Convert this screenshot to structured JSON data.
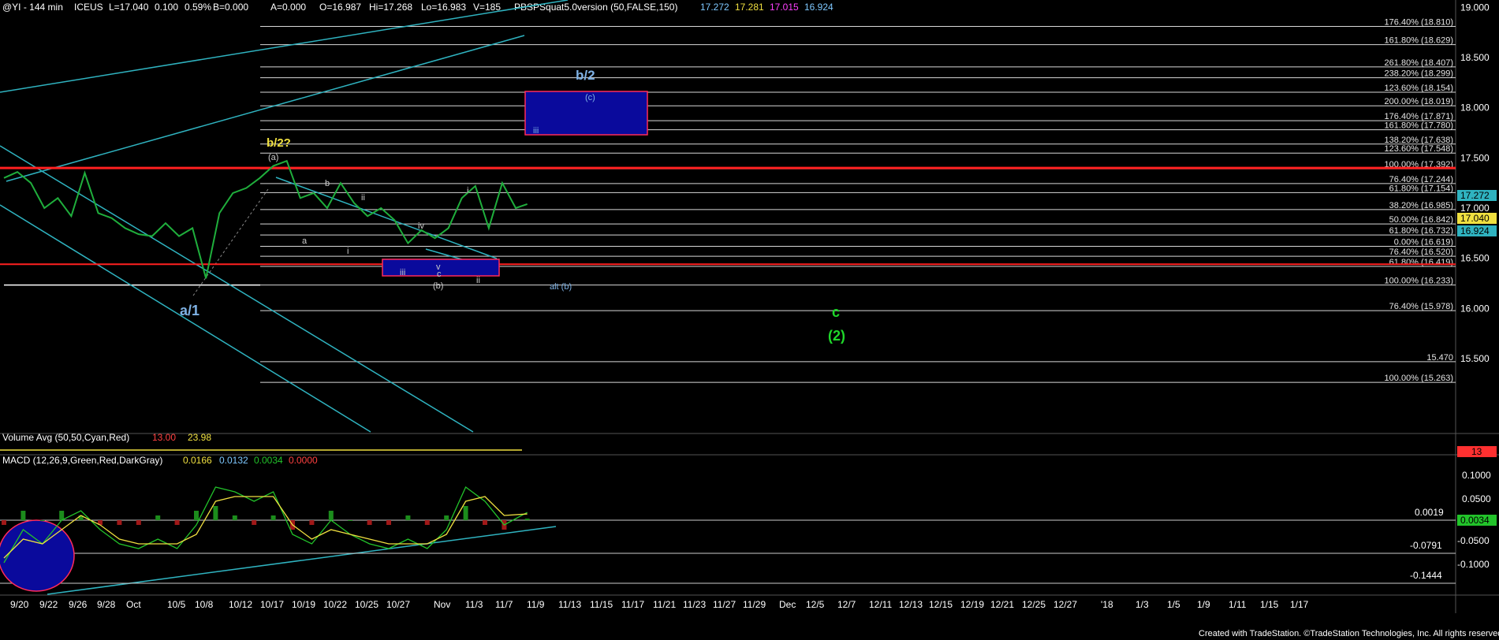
{
  "header": {
    "symbol": "@YI - 144 min",
    "exchange": "ICEUS",
    "last": "L=17.040",
    "change": "0.100",
    "change_pct": "0.59%",
    "b": "B=0.000",
    "a": "A=0.000",
    "open": "O=16.987",
    "hi": "Hi=17.268",
    "lo": "Lo=16.983",
    "vol": "V=185",
    "study": "PBSPSquat5.0version (50,FALSE,150)",
    "v1": "17.272",
    "v2": "17.281",
    "v3": "17.015",
    "v4": "16.924"
  },
  "colors": {
    "background": "#000000",
    "price_bars": "#1fae3c",
    "fib_line": "#e6e6e6",
    "fib_text": "#e6e6e6",
    "red_level": "#ff2020",
    "channel": "#2fb3c0",
    "box_fill": "#0a0a9c",
    "box_border": "#ff2b5a",
    "wave_label_blue": "#7fb2e5",
    "wave_label_yellow": "#f0e040",
    "wave_label_green": "#1fd82a",
    "macd_line": "#22c32a",
    "signal_line": "#f0e040",
    "hist_pos": "#1c8c1c",
    "hist_neg": "#a01818"
  },
  "chart_data": [
    {
      "type": "line",
      "title": "",
      "xlabel": "",
      "ylabel": "",
      "ylim": [
        15.15,
        19.03
      ],
      "price_axis_ticks": [
        "19.000",
        "18.500",
        "18.000",
        "17.500",
        "17.000",
        "16.500",
        "16.000",
        "15.500"
      ],
      "date_axis_ticks": [
        "9/20",
        "9/22",
        "9/26",
        "9/28",
        "Oct",
        "10/5",
        "10/8",
        "10/12",
        "10/17",
        "10/19",
        "10/22",
        "10/25",
        "10/27",
        "Nov",
        "11/3",
        "11/7",
        "11/9",
        "11/13",
        "11/15",
        "11/17",
        "11/21",
        "11/23",
        "11/27",
        "11/29",
        "Dec",
        "12/5",
        "12/7",
        "12/11",
        "12/13",
        "12/15",
        "12/19",
        "12/21",
        "12/25",
        "12/27",
        "'18",
        "1/3",
        "1/5",
        "1/9",
        "1/11",
        "1/15",
        "1/17"
      ],
      "series": [
        {
          "x": [
            0,
            14,
            28,
            42,
            56,
            70,
            84,
            98,
            112,
            126,
            140,
            154,
            168,
            182,
            196,
            210,
            224,
            238,
            252,
            266,
            280,
            294,
            308,
            322,
            336,
            350,
            364,
            378,
            392,
            406,
            420,
            434,
            448,
            462,
            476,
            490,
            504,
            518,
            532,
            544
          ],
          "values": [
            17.3,
            17.36,
            17.25,
            17.0,
            17.1,
            16.92,
            17.35,
            16.95,
            16.9,
            16.8,
            16.74,
            16.72,
            16.85,
            16.72,
            16.8,
            16.3,
            16.95,
            17.15,
            17.2,
            17.3,
            17.42,
            17.47,
            17.1,
            17.15,
            17.0,
            17.25,
            17.05,
            16.92,
            17.0,
            16.88,
            16.65,
            16.78,
            16.7,
            16.8,
            17.1,
            17.22,
            16.8,
            17.25,
            17.0,
            17.04
          ]
        }
      ],
      "fib_levels": [
        {
          "label": "176.40% (18.810)",
          "value": 18.81
        },
        {
          "label": "161.80% (18.629)",
          "value": 18.629
        },
        {
          "label": "261.80% (18.407)",
          "value": 18.407
        },
        {
          "label": "238.20% (18.299)",
          "value": 18.299
        },
        {
          "label": "123.60% (18.154)",
          "value": 18.154
        },
        {
          "label": "200.00% (18.019)",
          "value": 18.019
        },
        {
          "label": "176.40% (17.871)",
          "value": 17.871
        },
        {
          "label": "161.80% (17.780)",
          "value": 17.78
        },
        {
          "label": "138.20% (17.638)",
          "value": 17.638
        },
        {
          "label": "123.60% (17.548)",
          "value": 17.548
        },
        {
          "label": "100.00% (17.392)",
          "value": 17.392
        },
        {
          "label": "76.40% (17.244)",
          "value": 17.244
        },
        {
          "label": "61.80% (17.154)",
          "value": 17.154
        },
        {
          "label": "38.20% (16.985)",
          "value": 16.985
        },
        {
          "label": "50.00% (16.842)",
          "value": 16.842
        },
        {
          "label": "61.80% (16.732)",
          "value": 16.732
        },
        {
          "label": "0.00% (16.619)",
          "value": 16.619
        },
        {
          "label": "76.40% (16.520)",
          "value": 16.52
        },
        {
          "label": "61.80% (16.419)",
          "value": 16.419
        },
        {
          "label": "100.00% (16.233)",
          "value": 16.233
        },
        {
          "label": "76.40% (15.978)",
          "value": 15.978
        },
        {
          "label": "15.470",
          "value": 15.47
        },
        {
          "label": "100.00% (15.263)",
          "value": 15.263
        }
      ],
      "red_levels": [
        17.4,
        16.44
      ],
      "wave_labels": {
        "b2_top": "b/2",
        "c_paren": "(c)",
        "iii_box": "iii",
        "b2q": "b/2?",
        "a_paren": "(a)",
        "b_small": "b",
        "ii_small": "ii",
        "a_small": "a",
        "i_small": "i",
        "i_right": "i",
        "iv": "iv",
        "iii_low": "iii",
        "v_low": "v",
        "c_low": "c",
        "b_paren": "(b)",
        "ii_right": "ii",
        "a1": "a/1",
        "alt_b": "alt (b)",
        "c_green": "c",
        "two_green": "(2)"
      },
      "price_badges": [
        {
          "value": "17.272"
        },
        {
          "value": "17.040"
        },
        {
          "value": "16.924"
        }
      ]
    },
    {
      "type": "bar",
      "title": "Volume Avg (50,50,Cyan,Red)",
      "legend_values": [
        "13.00",
        "23.98"
      ],
      "axis_badge": "13"
    },
    {
      "type": "line",
      "title": "MACD (12,26,9,Green,Red,DarkGray)",
      "legend_values": [
        "0.0166",
        "0.0132",
        "0.0034",
        "0.0000"
      ],
      "axis_ticks": [
        "0.1000",
        "0.0500",
        "-0.0500",
        "-0.1000"
      ],
      "level_labels": [
        "0.0019",
        "-0.0791",
        "-0.1444"
      ],
      "axis_badge": "0.0034",
      "series": [
        {
          "name": "MACD",
          "x": [
            0,
            20,
            40,
            60,
            80,
            100,
            120,
            140,
            160,
            180,
            200,
            220,
            240,
            260,
            280,
            300,
            320,
            340,
            360,
            380,
            400,
            420,
            440,
            460,
            480,
            500,
            520,
            544
          ],
          "values": [
            -0.09,
            -0.02,
            -0.05,
            0.0,
            0.02,
            -0.02,
            -0.05,
            -0.06,
            -0.04,
            -0.06,
            -0.01,
            0.07,
            0.06,
            0.04,
            0.06,
            -0.03,
            -0.05,
            0.0,
            -0.03,
            -0.05,
            -0.06,
            -0.04,
            -0.06,
            -0.02,
            0.07,
            0.04,
            -0.01,
            0.0166
          ]
        },
        {
          "name": "Signal",
          "x": [
            0,
            20,
            40,
            60,
            80,
            100,
            120,
            140,
            160,
            180,
            200,
            220,
            240,
            260,
            280,
            300,
            320,
            340,
            360,
            380,
            400,
            420,
            440,
            460,
            480,
            500,
            520,
            544
          ],
          "values": [
            -0.08,
            -0.04,
            -0.05,
            -0.02,
            0.01,
            -0.01,
            -0.04,
            -0.05,
            -0.05,
            -0.05,
            -0.03,
            0.04,
            0.05,
            0.05,
            0.05,
            -0.01,
            -0.04,
            -0.02,
            -0.03,
            -0.04,
            -0.05,
            -0.05,
            -0.05,
            -0.03,
            0.04,
            0.05,
            0.01,
            0.0132
          ]
        }
      ]
    }
  ],
  "footer": {
    "credit": "Created with TradeStation. ©TradeStation Technologies, Inc. All rights reserved."
  }
}
